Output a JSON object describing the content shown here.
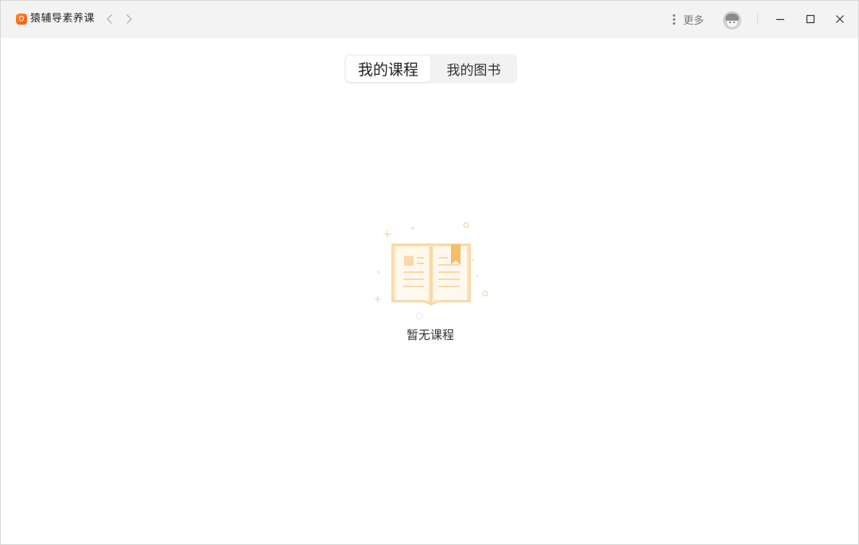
{
  "app": {
    "title": "猿辅导素养课",
    "logo_icon": "ape-logo-icon",
    "brand_color": "#f5701f"
  },
  "titlebar": {
    "more_label": "更多",
    "back_icon": "chevron-left-icon",
    "forward_icon": "chevron-right-icon",
    "more_icon": "vertical-dots-icon",
    "avatar_icon": "user-avatar-icon",
    "minimize_icon": "minimize-icon",
    "maximize_icon": "maximize-icon",
    "close_icon": "close-icon"
  },
  "tabs": [
    {
      "label": "我的课程",
      "active": true
    },
    {
      "label": "我的图书",
      "active": false
    }
  ],
  "empty_state": {
    "icon": "open-book-icon",
    "message": "暂无课程",
    "accent_color": "#f8d49e"
  }
}
